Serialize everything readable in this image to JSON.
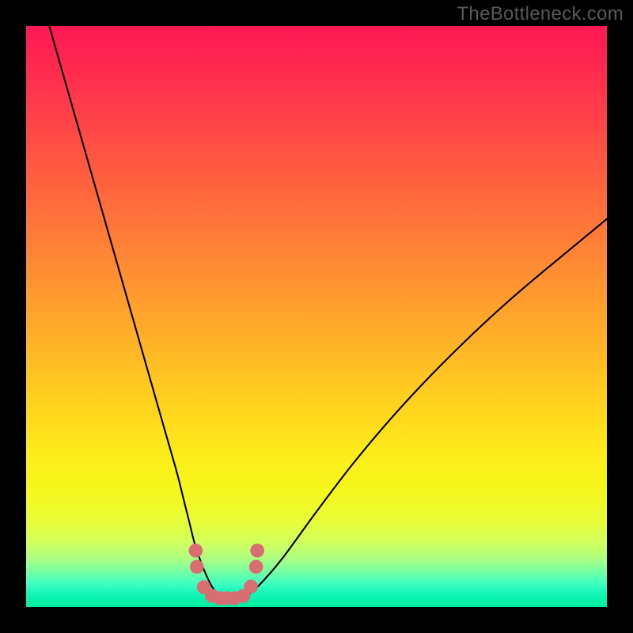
{
  "watermark": "TheBottleneck.com",
  "chart_data": {
    "type": "line",
    "title": "",
    "xlabel": "",
    "ylabel": "",
    "xlim": [
      0,
      100
    ],
    "ylim": [
      0,
      100
    ],
    "grid": false,
    "series": [
      {
        "name": "bottleneck-curve",
        "color": "#000000",
        "x": [
          4,
          6,
          8,
          10,
          12,
          14,
          16,
          18,
          20,
          22,
          24,
          26,
          27,
          28,
          29,
          30,
          31,
          32,
          33,
          34,
          35,
          36,
          37,
          38,
          40,
          44,
          50,
          56,
          62,
          68,
          74,
          80,
          86,
          92,
          100
        ],
        "y": [
          100,
          93,
          86,
          79,
          72,
          65,
          58,
          51,
          44,
          37,
          30,
          23,
          19,
          15,
          11,
          8,
          5.5,
          3.5,
          2.2,
          1.4,
          1.0,
          1.0,
          1.3,
          1.9,
          3.6,
          8.2,
          16.4,
          24.3,
          31.5,
          38.1,
          44.2,
          49.9,
          55.2,
          60.2,
          66.8
        ]
      }
    ],
    "markers": {
      "name": "data-points",
      "color": "#d86e71",
      "radius_scale": 0.95,
      "points": [
        {
          "x": 29.2,
          "y": 9.7
        },
        {
          "x": 29.4,
          "y": 6.9
        },
        {
          "x": 30.6,
          "y": 3.4
        },
        {
          "x": 32.0,
          "y": 1.9
        },
        {
          "x": 33.4,
          "y": 1.5
        },
        {
          "x": 34.6,
          "y": 1.5
        },
        {
          "x": 35.9,
          "y": 1.5
        },
        {
          "x": 37.4,
          "y": 1.9
        },
        {
          "x": 38.7,
          "y": 3.5
        },
        {
          "x": 39.6,
          "y": 6.9
        },
        {
          "x": 39.8,
          "y": 9.7
        }
      ]
    },
    "background_gradient": {
      "top": "#ff1854",
      "mid": "#ffd21e",
      "bottom": "#00ee9f"
    }
  }
}
